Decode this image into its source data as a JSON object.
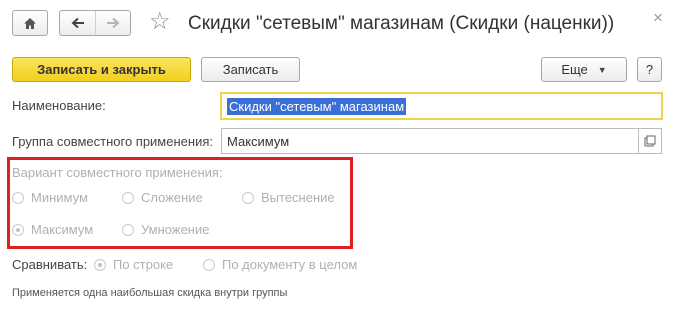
{
  "window": {
    "title": "Скидки \"сетевым\" магазинам (Скидки (наценки))",
    "close_glyph": "×",
    "star_glyph": "☆"
  },
  "toolbar": {
    "save_close_label": "Записать и закрыть",
    "save_label": "Записать",
    "more_label": "Еще",
    "help_label": "?"
  },
  "form": {
    "name_label": "Наименование:",
    "name_value": "Скидки \"сетевым\" магазинам",
    "group_label": "Группа совместного применения:",
    "group_value": "Максимум",
    "variant_label": "Вариант совместного применения:",
    "variant_options": [
      {
        "label": "Минимум",
        "selected": false
      },
      {
        "label": "Сложение",
        "selected": false
      },
      {
        "label": "Вытеснение",
        "selected": false
      },
      {
        "label": "Максимум",
        "selected": true
      },
      {
        "label": "Умножение",
        "selected": false
      }
    ],
    "compare_label": "Сравнивать:",
    "compare_options": [
      {
        "label": "По строке",
        "selected": true
      },
      {
        "label": "По документу в целом",
        "selected": false
      }
    ],
    "footnote": "Применяется одна наибольшая скидка внутри группы"
  },
  "colors": {
    "accent_yellow": "#f7d73a",
    "highlight_red": "#e02020",
    "selection_blue": "#3a6fd8"
  }
}
